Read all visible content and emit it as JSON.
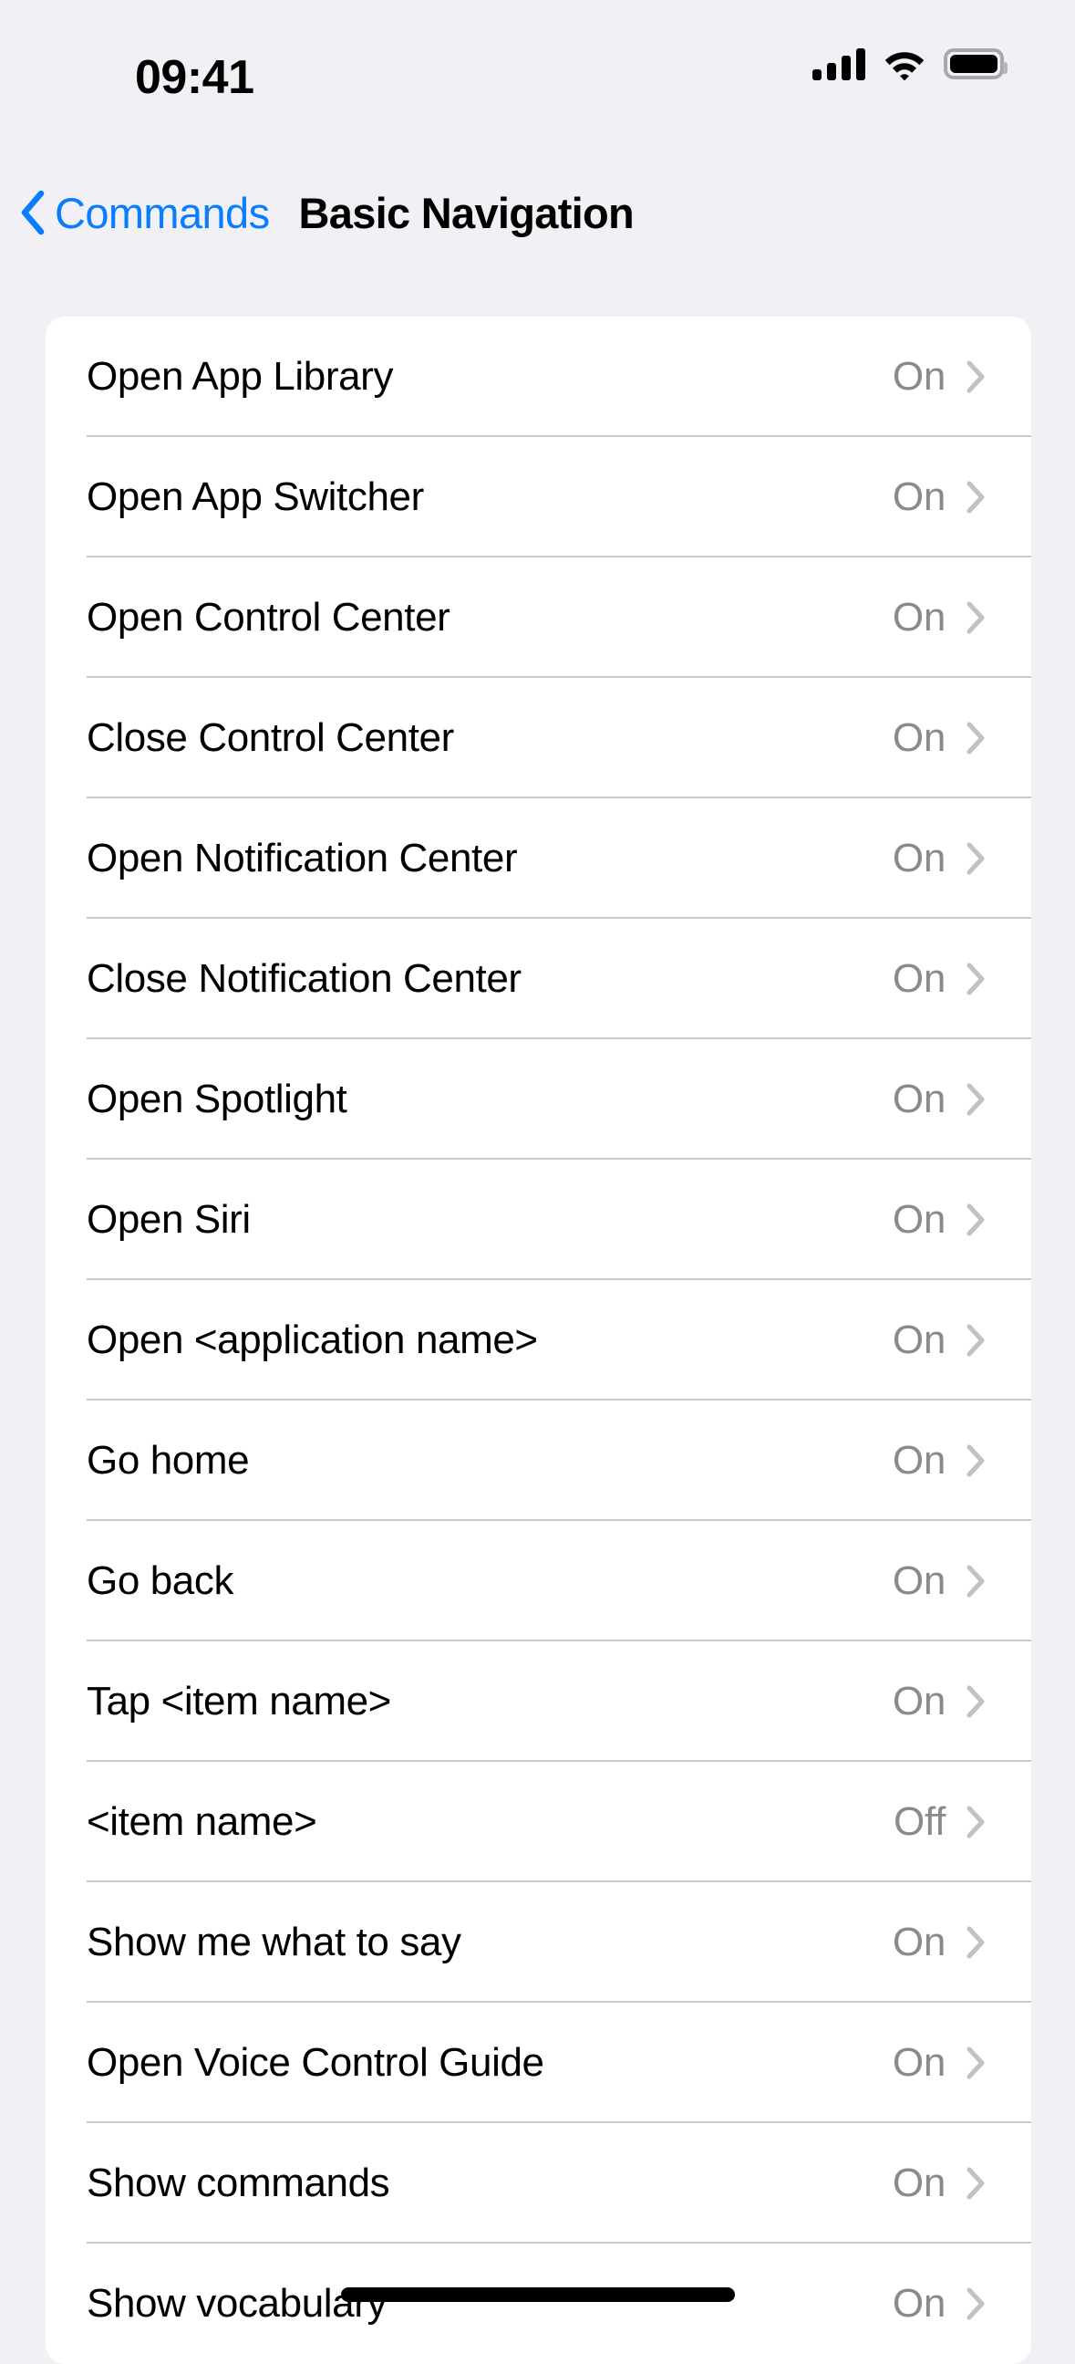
{
  "status_bar": {
    "time": "09:41",
    "cellular_icon": "cellular-signal-icon",
    "wifi_icon": "wifi-icon",
    "battery_icon": "battery-icon",
    "signal_bars": 4,
    "battery_level": 100
  },
  "nav_bar": {
    "back_label": "Commands",
    "back_icon": "chevron-left-icon",
    "title": "Basic Navigation",
    "accent_color": "#0a7cff"
  },
  "list": {
    "value_on": "On",
    "value_off": "Off",
    "disclosure_icon": "chevron-right-icon",
    "rows": [
      {
        "label": "Open App Library",
        "value": "On"
      },
      {
        "label": "Open App Switcher",
        "value": "On"
      },
      {
        "label": "Open Control Center",
        "value": "On"
      },
      {
        "label": "Close Control Center",
        "value": "On"
      },
      {
        "label": "Open Notification Center",
        "value": "On"
      },
      {
        "label": "Close Notification Center",
        "value": "On"
      },
      {
        "label": "Open Spotlight",
        "value": "On"
      },
      {
        "label": "Open Siri",
        "value": "On"
      },
      {
        "label": "Open <application name>",
        "value": "On"
      },
      {
        "label": "Go home",
        "value": "On"
      },
      {
        "label": "Go back",
        "value": "On"
      },
      {
        "label": "Tap <item name>",
        "value": "On"
      },
      {
        "label": "<item name>",
        "value": "Off"
      },
      {
        "label": "Show me what to say",
        "value": "On"
      },
      {
        "label": "Open Voice Control Guide",
        "value": "On"
      },
      {
        "label": "Show commands",
        "value": "On"
      },
      {
        "label": "Show vocabulary",
        "value": "On"
      }
    ]
  },
  "home_indicator": {
    "name": "home-indicator",
    "color": "#000000"
  }
}
